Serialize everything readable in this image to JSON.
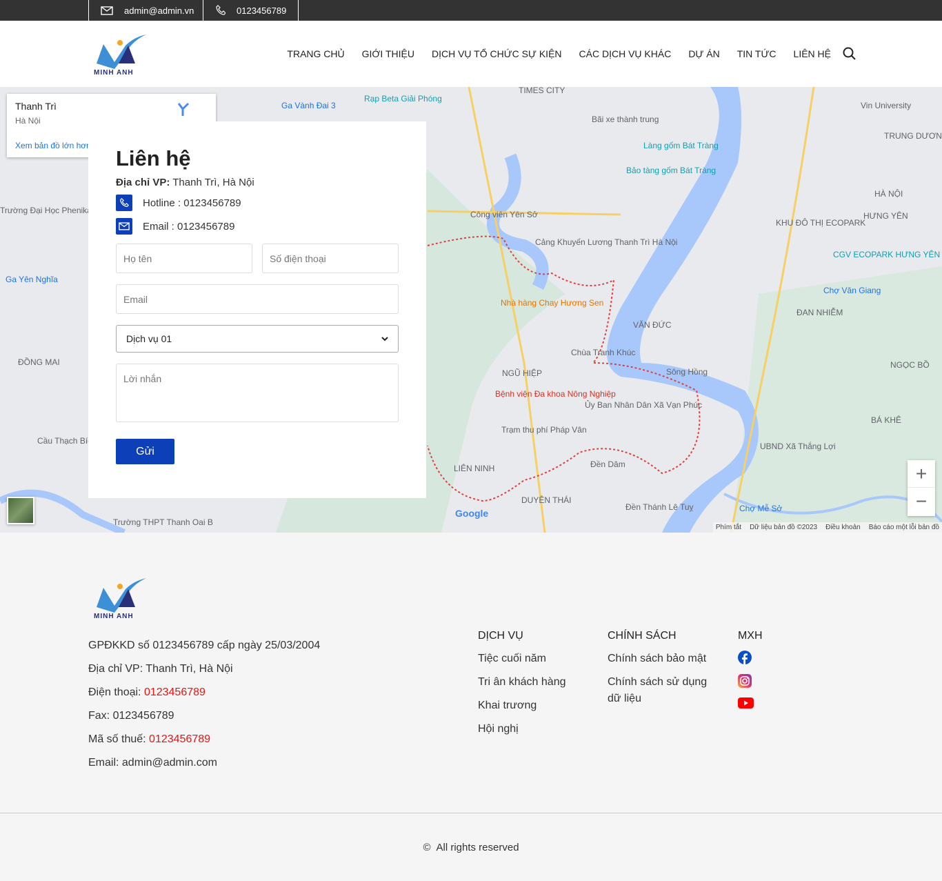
{
  "topbar": {
    "email": "admin@admin.vn",
    "phone": "0123456789"
  },
  "header": {
    "logo_text": "MINH ANH",
    "nav": [
      "TRANG CHỦ",
      "GIỚI THIỆU",
      "DỊCH VỤ TỔ CHỨC SỰ KIỆN",
      "CÁC DỊCH VỤ KHÁC",
      "DỰ ÁN",
      "TIN TỨC",
      "LIÊN HỆ"
    ]
  },
  "map": {
    "info": {
      "title": "Thanh Trì",
      "subtitle": "Hà Nội",
      "link": "Xem bản đồ lớn hơn"
    },
    "labels": [
      "Ga Vành Đai 3",
      "Rạp Beta Giải Phóng",
      "TIMES CITY",
      "Bãi xe thành trung",
      "Làng gốm Bát Tràng",
      "Bảo tàng gốm Bát Tràng",
      "Vin University",
      "TRUNG DƯƠNG",
      "HÀ NỘI",
      "HƯNG YÊN",
      "KHU ĐÔ THỊ ECOPARK",
      "CGV ECOPARK HƯNG YÊN",
      "Chợ Văn Giang",
      "ĐAN NHIỄM",
      "Cảng Khuyến Lương Thanh Trì Hà Nội",
      "Công viên Yên Sở",
      "Nhà hàng Chay Hương Sen",
      "Chùa Tranh Khúc",
      "Sông Hồng",
      "Bệnh viện Đa khoa Nông Nghiệp",
      "Ủy Ban Nhân Dân Xã Vạn Phúc",
      "Trạm thu phí Pháp Vân",
      "Đền Dâm",
      "UBND Xã Thắng Lợi",
      "Đền Thánh Lê Tuỵ",
      "Chợ Mễ Sở",
      "NGỌC BỒ",
      "BÁ KHÊ",
      "Trường Đại Học Phenikaa",
      "Ga Yên Nghĩa",
      "ĐỒNG MAI",
      "Cầu Thạch Bích",
      "Trường THPT Thanh Oai B",
      "VĂN ĐỨC",
      "NGŨ HIỆP",
      "DUYÊN THÁI",
      "LIÊN NINH"
    ],
    "attribution": [
      "Phím tắt",
      "Dữ liệu bản đồ ©2023",
      "Điều khoản",
      "Báo cáo một lỗi bản đồ"
    ],
    "google": "Google",
    "zoom_in": "+",
    "zoom_out": "−"
  },
  "contact": {
    "title": "Liên hệ",
    "address_label": "Địa chỉ VP:",
    "address": "Thanh Trì, Hà Nội",
    "hotline": "Hotline : 0123456789",
    "email": "Email : 0123456789",
    "form": {
      "name_placeholder": "Họ tên",
      "phone_placeholder": "Số điện thoại",
      "email_placeholder": "Email",
      "service_selected": "Dịch vụ 01",
      "message_placeholder": "Lời nhắn",
      "submit": "Gửi"
    }
  },
  "footer": {
    "info": {
      "license": "GPĐKKD số 0123456789 cấp ngày 25/03/2004",
      "address": "Địa chỉ VP: Thanh Trì, Hà Nội",
      "phone_label": "Điện thoại: ",
      "phone": "0123456789",
      "fax": "Fax: 0123456789",
      "tax_label": "Mã số thuế: ",
      "tax": "0123456789",
      "email": "Email: admin@admin.com"
    },
    "services": {
      "title": "DỊCH VỤ",
      "items": [
        "Tiệc cuối năm",
        "Tri ân khách hàng",
        "Khai trương",
        "Hội nghị"
      ]
    },
    "policy": {
      "title": "CHÍNH SÁCH",
      "items": [
        "Chính sách bảo mật",
        "Chính sách sử dụng dữ liệu"
      ]
    },
    "social": {
      "title": "MXH",
      "icons": [
        "facebook-icon",
        "instagram-icon",
        "youtube-icon"
      ]
    },
    "copyright": "All rights reserved"
  },
  "colors": {
    "accent": "#0d3fb8",
    "topbar": "#333333",
    "highlight": "#ee1111"
  }
}
